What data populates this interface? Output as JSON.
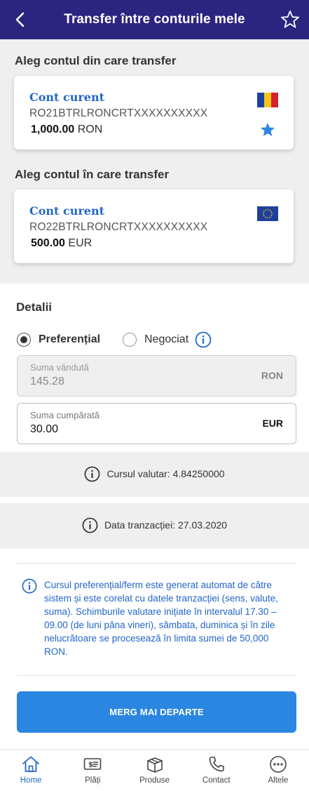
{
  "header": {
    "title": "Transfer între conturile mele"
  },
  "from_section": {
    "title": "Aleg contul din care transfer",
    "account": {
      "name": "Cont curent",
      "iban": "RO21BTRLRONCRTXXXXXXXXXX",
      "amount": "1,000.00",
      "currency": "RON",
      "flag": "romania-flag",
      "favorite": true
    }
  },
  "to_section": {
    "title": "Aleg contul în care transfer",
    "account": {
      "name": "Cont curent",
      "iban": "RO22BTRLRONCRTXXXXXXXXXX",
      "amount": "500.00",
      "currency": "EUR",
      "flag": "eu-flag"
    }
  },
  "details": {
    "title": "Detalii",
    "options": [
      {
        "label": "Preferențial",
        "selected": true
      },
      {
        "label": "Negociat",
        "selected": false
      }
    ],
    "sold": {
      "label": "Suma vândută",
      "value": "145.28",
      "currency": "RON"
    },
    "bought": {
      "label": "Suma cumpărată",
      "value": "30.00",
      "currency": "EUR"
    }
  },
  "exchange_rate": {
    "text": "Cursul valutar: 4.84250000"
  },
  "transaction_date": {
    "text": "Data tranzacției: 27.03.2020"
  },
  "disclaimer": "Cursul preferențial/ferm este generat automat de către sistem și este corelat cu datele tranzacției (sens, valute, suma). Schimburile valutare inițiate în intervalul 17.30 – 09.00 (de luni pâna vineri), sâmbata, duminica și în zile nelucrătoare se procesează în limita sumei de 50,000 RON.",
  "primary_button": "MERG MAI DEPARTE",
  "tabbar": [
    {
      "label": "Home",
      "icon": "home-icon",
      "active": true
    },
    {
      "label": "Plăți",
      "icon": "payments-icon",
      "active": false
    },
    {
      "label": "Produse",
      "icon": "box-icon",
      "active": false
    },
    {
      "label": "Contact",
      "icon": "phone-icon",
      "active": false
    },
    {
      "label": "Altele",
      "icon": "more-icon",
      "active": false
    }
  ],
  "colors": {
    "header": "#2b2580",
    "accent": "#2366c8",
    "button": "#2b86e2"
  }
}
